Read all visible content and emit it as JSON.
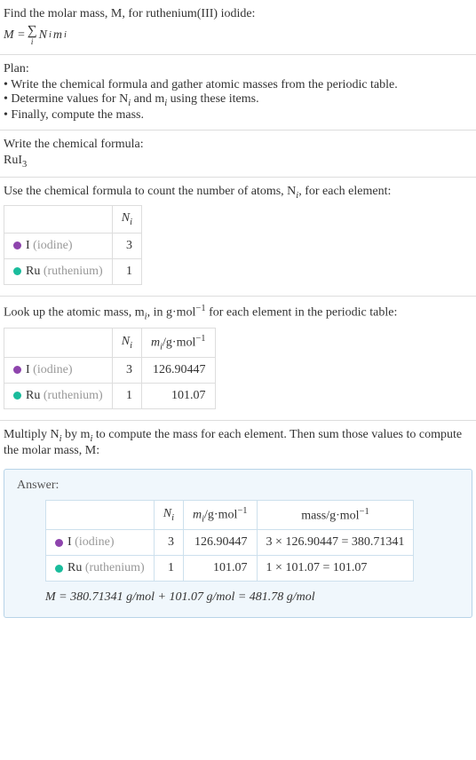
{
  "intro": {
    "line1": "Find the molar mass, M, for ruthenium(III) iodide:",
    "eq_lhs": "M = ",
    "eq_sigma": "∑",
    "eq_sigma_sub": "i",
    "eq_rhs": "N",
    "eq_rhs_sub1": "i",
    "eq_rhs2": "m",
    "eq_rhs_sub2": "i"
  },
  "plan": {
    "title": "Plan:",
    "items": [
      "• Write the chemical formula and gather atomic masses from the periodic table.",
      "• Determine values for N",
      "• Finally, compute the mass."
    ],
    "item2_sub1": "i",
    "item2_mid": " and m",
    "item2_sub2": "i",
    "item2_end": " using these items."
  },
  "step1": {
    "title": "Write the chemical formula:",
    "formula_base": "RuI",
    "formula_sub": "3"
  },
  "step2": {
    "title_a": "Use the chemical formula to count the number of atoms, N",
    "title_sub": "i",
    "title_b": ", for each element:",
    "header_N": "N",
    "header_N_sub": "i",
    "rows": [
      {
        "color": "dot-purple",
        "sym": "I",
        "name": "(iodine)",
        "n": "3"
      },
      {
        "color": "dot-teal",
        "sym": "Ru",
        "name": "(ruthenium)",
        "n": "1"
      }
    ]
  },
  "step3": {
    "title_a": "Look up the atomic mass, m",
    "title_sub1": "i",
    "title_b": ", in g·mol",
    "title_sup": "−1",
    "title_c": " for each element in the periodic table:",
    "header_N": "N",
    "header_N_sub": "i",
    "header_m": "m",
    "header_m_sub": "i",
    "header_m_unit": "/g·mol",
    "header_m_sup": "−1",
    "rows": [
      {
        "color": "dot-purple",
        "sym": "I",
        "name": "(iodine)",
        "n": "3",
        "m": "126.90447"
      },
      {
        "color": "dot-teal",
        "sym": "Ru",
        "name": "(ruthenium)",
        "n": "1",
        "m": "101.07"
      }
    ]
  },
  "step4": {
    "title_a": "Multiply N",
    "title_sub1": "i",
    "title_b": " by m",
    "title_sub2": "i",
    "title_c": " to compute the mass for each element. Then sum those values to compute the molar mass, M:"
  },
  "answer": {
    "label": "Answer:",
    "header_N": "N",
    "header_N_sub": "i",
    "header_m": "m",
    "header_m_sub": "i",
    "header_m_unit": "/g·mol",
    "header_m_sup": "−1",
    "header_mass": "mass/g·mol",
    "header_mass_sup": "−1",
    "rows": [
      {
        "color": "dot-purple",
        "sym": "I",
        "name": "(iodine)",
        "n": "3",
        "m": "126.90447",
        "calc": "3 × 126.90447 = 380.71341"
      },
      {
        "color": "dot-teal",
        "sym": "Ru",
        "name": "(ruthenium)",
        "n": "1",
        "m": "101.07",
        "calc": "1 × 101.07 = 101.07"
      }
    ],
    "final": "M = 380.71341 g/mol + 101.07 g/mol = 481.78 g/mol"
  },
  "chart_data": {
    "type": "table",
    "compound": "ruthenium(III) iodide",
    "formula": "RuI3",
    "elements": [
      {
        "symbol": "I",
        "name": "iodine",
        "N_i": 3,
        "m_i_g_per_mol": 126.90447,
        "mass_g_per_mol": 380.71341
      },
      {
        "symbol": "Ru",
        "name": "ruthenium",
        "N_i": 1,
        "m_i_g_per_mol": 101.07,
        "mass_g_per_mol": 101.07
      }
    ],
    "molar_mass_g_per_mol": 481.78
  }
}
